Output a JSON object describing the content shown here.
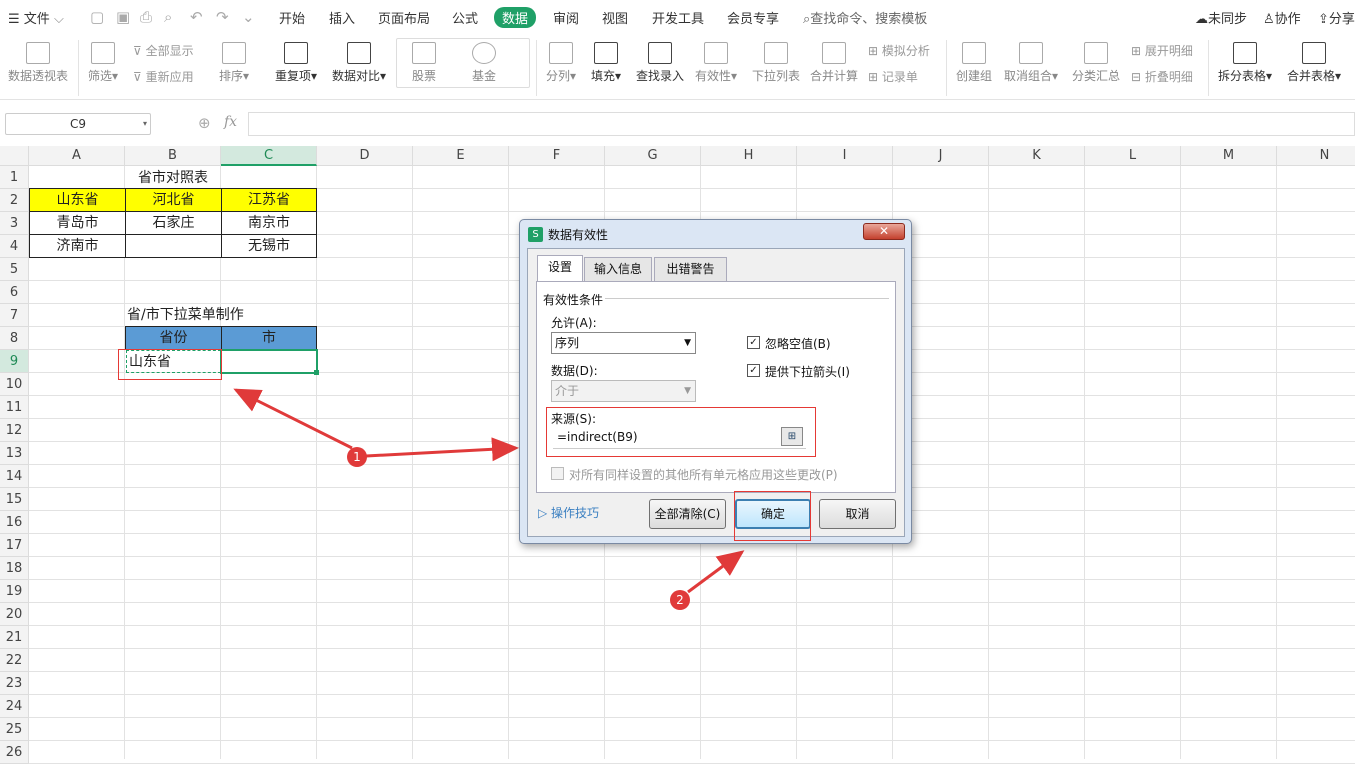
{
  "menubar": {
    "file_label": "文件",
    "tabs": [
      "开始",
      "插入",
      "页面布局",
      "公式",
      "数据",
      "审阅",
      "视图",
      "开发工具",
      "会员专享"
    ],
    "active_tab": "数据",
    "search_placeholder": "查找命令、搜索模板",
    "sync_label": "未同步",
    "collab_label": "协作",
    "share_label": "分享"
  },
  "ribbon": {
    "pivot": "数据透视表",
    "filter": "筛选",
    "show_all": "全部显示",
    "reapply": "重新应用",
    "sort": "排序",
    "duplicates": "重复项",
    "compare": "数据对比",
    "stocks": "股票",
    "funds": "基金",
    "split_col": "分列",
    "fill": "填充",
    "lookup": "查找录入",
    "validity": "有效性",
    "dropdown": "下拉列表",
    "consolidate": "合并计算",
    "simulate": "模拟分析",
    "record": "记录单",
    "create_group": "创建组",
    "ungroup": "取消组合",
    "subtotal": "分类汇总",
    "expand": "展开明细",
    "collapse": "折叠明细",
    "split_table": "拆分表格",
    "merge_table": "合并表格"
  },
  "formula_bar": {
    "name_box": "C9",
    "fx": "fx",
    "formula": ""
  },
  "sheet": {
    "columns": [
      "A",
      "B",
      "C",
      "D",
      "E",
      "F",
      "G",
      "H",
      "I",
      "J",
      "K",
      "L",
      "M",
      "N"
    ],
    "selected_column": "C",
    "rows": [
      "1",
      "2",
      "3",
      "4",
      "5",
      "6",
      "7",
      "8",
      "9",
      "10",
      "11",
      "12",
      "13",
      "14",
      "15",
      "16",
      "17",
      "18",
      "19",
      "20",
      "21",
      "22",
      "23",
      "24",
      "25",
      "26"
    ],
    "selected_row": "9",
    "title_cell": "省市对照表",
    "provinces": [
      "山东省",
      "河北省",
      "江苏省"
    ],
    "row3": [
      "青岛市",
      "石家庄",
      "南京市"
    ],
    "row4": [
      "济南市",
      "",
      "无锡市"
    ],
    "menu_title": "省/市下拉菜单制作",
    "hdr_province": "省份",
    "hdr_city": "市",
    "b9_value": "山东省"
  },
  "dialog": {
    "title": "数据有效性",
    "close": "✕",
    "tabs": [
      "设置",
      "输入信息",
      "出错警告"
    ],
    "section": "有效性条件",
    "allow_label": "允许(A):",
    "allow_value": "序列",
    "ignore_blank": "忽略空值(B)",
    "dropdown_arrow": "提供下拉箭头(I)",
    "data_label": "数据(D):",
    "data_value": "介于",
    "source_label": "来源(S):",
    "source_value": "=indirect(B9)",
    "apply_all": "对所有同样设置的其他所有单元格应用这些更改(P)",
    "tips": "操作技巧",
    "clear_all": "全部清除(C)",
    "ok": "确定",
    "cancel": "取消"
  },
  "annotations": {
    "badge1": "1",
    "badge2": "2",
    "color": "#e03a3a"
  }
}
